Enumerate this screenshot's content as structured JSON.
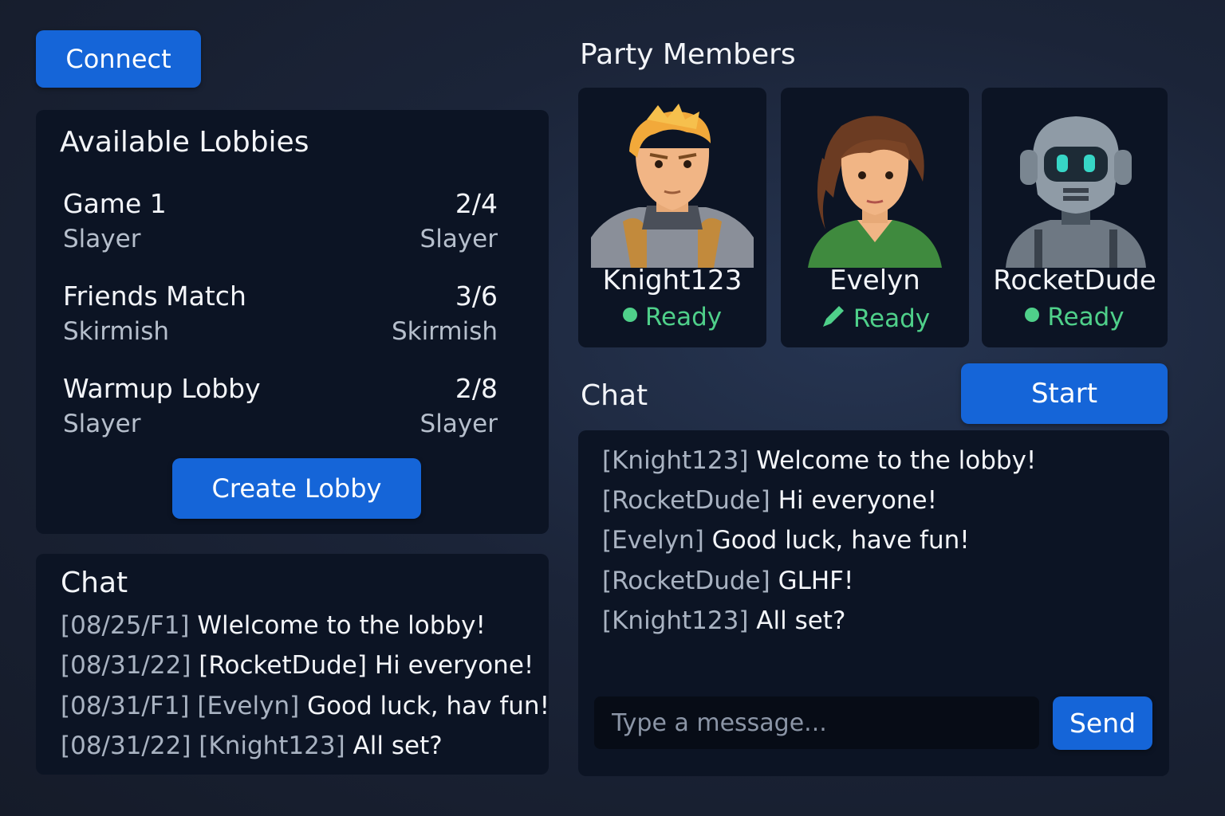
{
  "connect_button": "Connect",
  "lobbies": {
    "title": "Available Lobbies",
    "items": [
      {
        "name": "Game 1",
        "count": "2/4",
        "mode": "Slayer",
        "mode_right": "Slayer"
      },
      {
        "name": "Friends Match",
        "count": "3/6",
        "mode": "Skirmish",
        "mode_right": "Skirmish"
      },
      {
        "name": "Warmup Lobby",
        "count": "2/8",
        "mode": "Slayer",
        "mode_right": "Slayer"
      }
    ],
    "create_button": "Create Lobby"
  },
  "left_chat": {
    "title": "Chat",
    "messages": [
      {
        "stamp": "[08/25/F1]",
        "user": "",
        "text": "Wlelcome to the lobby!"
      },
      {
        "stamp": "[08/31/22]",
        "user": "[RocketDude]",
        "text": "Hi everyone!"
      },
      {
        "stamp": "[08/31/F1]",
        "user": "[Evelyn]",
        "text": "Good luck, hav fun!"
      },
      {
        "stamp": "[08/31/22]",
        "user": "[Knight123]",
        "text": "All set?"
      }
    ]
  },
  "party": {
    "title": "Party Members",
    "members": [
      {
        "name": "Knight123",
        "status": "Ready",
        "status_icon": "green-dot-icon",
        "avatar": "knight-avatar"
      },
      {
        "name": "Evelyn",
        "status": "Ready",
        "status_icon": "pencil-icon",
        "avatar": "woman-avatar"
      },
      {
        "name": "RocketDude",
        "status": "Ready",
        "status_icon": "green-dot-icon",
        "avatar": "robot-avatar"
      }
    ]
  },
  "right_chat": {
    "title": "Chat",
    "start_button": "Start",
    "messages": [
      {
        "user": "[Knight123]",
        "text": "Welcome to the lobby!"
      },
      {
        "user": "[RocketDude]",
        "text": "Hi everyone!"
      },
      {
        "user": "[Evelyn]",
        "text": "Good luck, have fun!"
      },
      {
        "user": "[RocketDude]",
        "text": "GLHF!"
      },
      {
        "user": "[Knight123]",
        "text": "All set?"
      }
    ],
    "input_placeholder": "Type a message...",
    "send_button": "Send"
  },
  "colors": {
    "accent": "#1565d8",
    "panel": "#0c1424",
    "ready": "#4fd08a"
  }
}
